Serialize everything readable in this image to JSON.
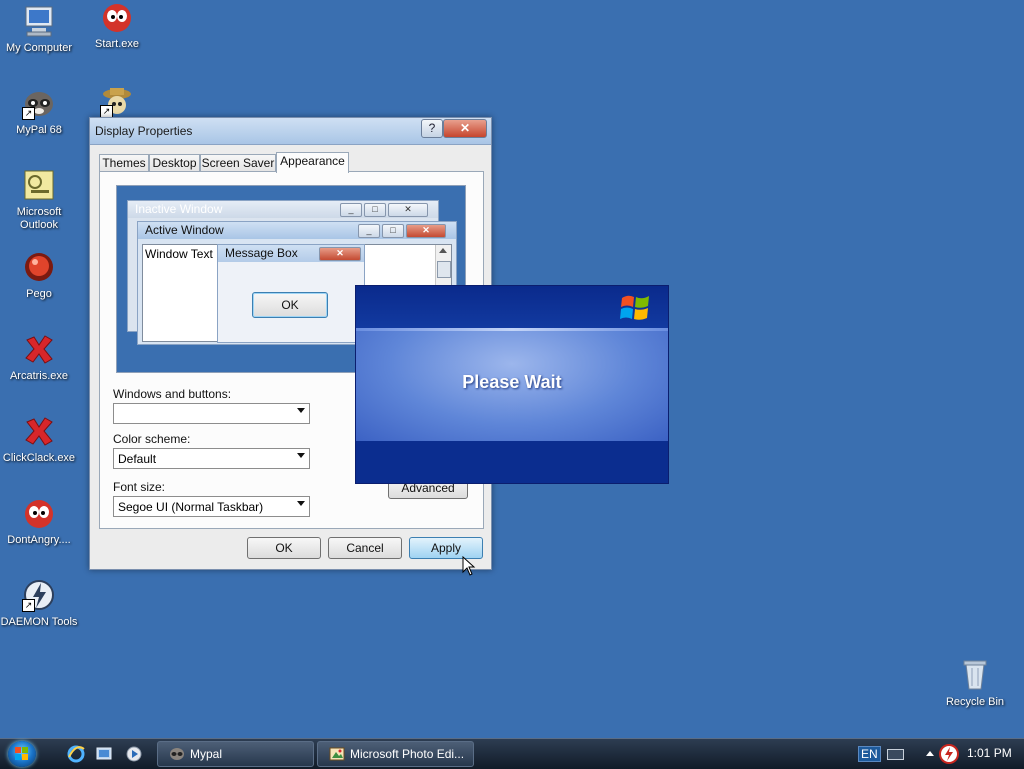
{
  "desktop": {
    "icons": [
      {
        "label": "My Computer"
      },
      {
        "label": "Start.exe"
      },
      {
        "label": "MyPal 68"
      },
      {
        "label": ""
      },
      {
        "label": "Microsoft Outlook"
      },
      {
        "label": "Pego"
      },
      {
        "label": "Arcatris.exe"
      },
      {
        "label": "ClickClack.exe"
      },
      {
        "label": "DontAngry...."
      },
      {
        "label": "DAEMON Tools"
      },
      {
        "label": "Recycle Bin"
      }
    ]
  },
  "dialog": {
    "title": "Display Properties",
    "help_glyph": "?",
    "close_glyph": "✕",
    "tabs": [
      "Themes",
      "Desktop",
      "Screen Saver",
      "Appearance"
    ],
    "preview": {
      "inactive_title": "Inactive Window",
      "active_title": "Active Window",
      "window_text": "Window Text",
      "message_box_title": "Message Box",
      "ok_label": "OK"
    },
    "windows_buttons_label": "Windows and buttons:",
    "windows_buttons_value": "",
    "color_scheme_label": "Color scheme:",
    "color_scheme_value": "Default",
    "font_size_label": "Font size:",
    "font_size_value": "Segoe UI (Normal Taskbar)",
    "advanced_label": "Advanced",
    "ok_label": "OK",
    "cancel_label": "Cancel",
    "apply_label": "Apply"
  },
  "wait_box": {
    "message": "Please Wait"
  },
  "taskbar": {
    "tasks": [
      {
        "label": "Mypal"
      },
      {
        "label": "Microsoft Photo Edi..."
      }
    ],
    "language": "EN",
    "clock": "1:01 PM"
  },
  "colors": {
    "desktop": "#3a6fb0",
    "wait_dark": "#0b2d8f",
    "wait_light": "#9cb6ec"
  }
}
